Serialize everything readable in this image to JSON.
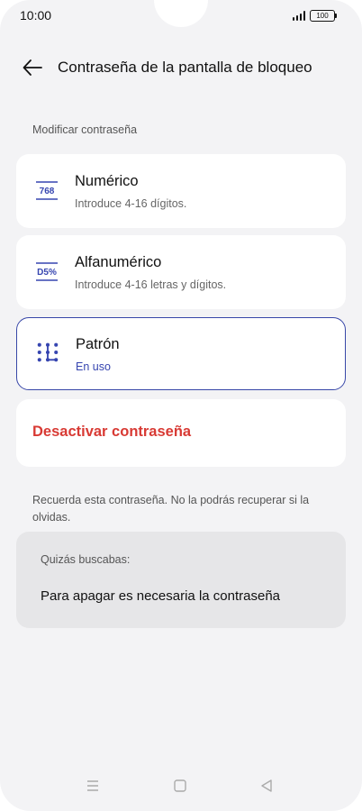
{
  "status_bar": {
    "time": "10:00",
    "battery": "100"
  },
  "header": {
    "title": "Contraseña de la pantalla de bloqueo"
  },
  "section": {
    "label": "Modificar contraseña"
  },
  "options": [
    {
      "icon_text": "768",
      "title": "Numérico",
      "subtitle": "Introduce 4-16 dígitos."
    },
    {
      "icon_text": "D5%",
      "title": "Alfanumérico",
      "subtitle": "Introduce 4-16 letras y dígitos."
    },
    {
      "title": "Patrón",
      "subtitle": "En uso"
    }
  ],
  "disable": {
    "label": "Desactivar contraseña"
  },
  "warning": "Recuerda esta contraseña. No la podrás recuperar si la olvidas.",
  "suggestions": {
    "label": "Quizás buscabas:",
    "item": "Para apagar es necesaria la contraseña"
  },
  "colors": {
    "accent": "#3645b0",
    "danger": "#d83a34"
  }
}
